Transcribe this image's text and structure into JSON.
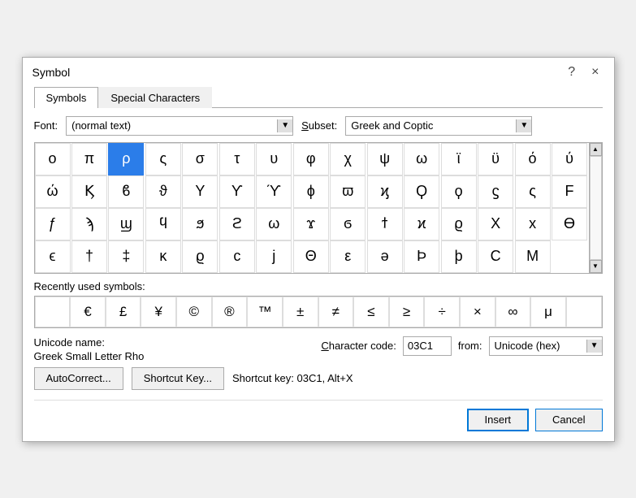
{
  "dialog": {
    "title": "Symbol",
    "help_label": "?",
    "close_label": "×"
  },
  "tabs": [
    {
      "id": "symbols",
      "label": "Symbols",
      "active": true
    },
    {
      "id": "special-characters",
      "label": "Special Characters",
      "active": false
    }
  ],
  "font_label": "Font:",
  "font_value": "(normal text)",
  "subset_label": "Subset:",
  "subset_value": "Greek and Coptic",
  "symbols": [
    "ο",
    "π",
    "ρ",
    "ς",
    "σ",
    "τ",
    "υ",
    "φ",
    "χ",
    "ψ",
    "ω",
    "ϊ",
    "ϋ",
    "ό",
    "ύ",
    "ώ",
    "Ϗ",
    "ϐ",
    "ϑ",
    "Υ",
    "ϒ",
    "ϓ",
    "ϕ",
    "ϖ",
    "ϗ",
    "Ϙ",
    "ϙ",
    "ϛ",
    "ς",
    "F",
    "ƒ",
    "ϡ",
    "ϣ",
    "ϥ",
    "ϧ",
    "ϩ",
    "ω",
    "ϫ",
    "ϭ",
    "ϯ",
    "ϰ",
    "ϱ",
    "Χ",
    "x",
    "ϴ",
    "ϵ",
    "†",
    "‡",
    "κ",
    "ϱ",
    "c",
    "j",
    "Θ",
    "ε",
    "ə",
    "Þ",
    "þ",
    "C",
    "M"
  ],
  "selected_symbol_index": 2,
  "recently_used_label": "Recently used symbols:",
  "recently_used": [
    "",
    "€",
    "£",
    "¥",
    "©",
    "®",
    "™",
    "±",
    "≠",
    "≤",
    "≥",
    "÷",
    "×",
    "∞",
    "μ",
    ""
  ],
  "unicode_name_label": "Unicode name:",
  "unicode_name_value": "Greek Small Letter Rho",
  "char_code_label": "Character code:",
  "char_code_value": "03C1",
  "from_label": "from:",
  "from_value": "Unicode (hex)",
  "autocorrect_label": "AutoCorrect...",
  "shortcut_key_label": "Shortcut Key...",
  "shortcut_text": "Shortcut key: 03C1, Alt+X",
  "insert_label": "Insert",
  "cancel_label": "Cancel"
}
